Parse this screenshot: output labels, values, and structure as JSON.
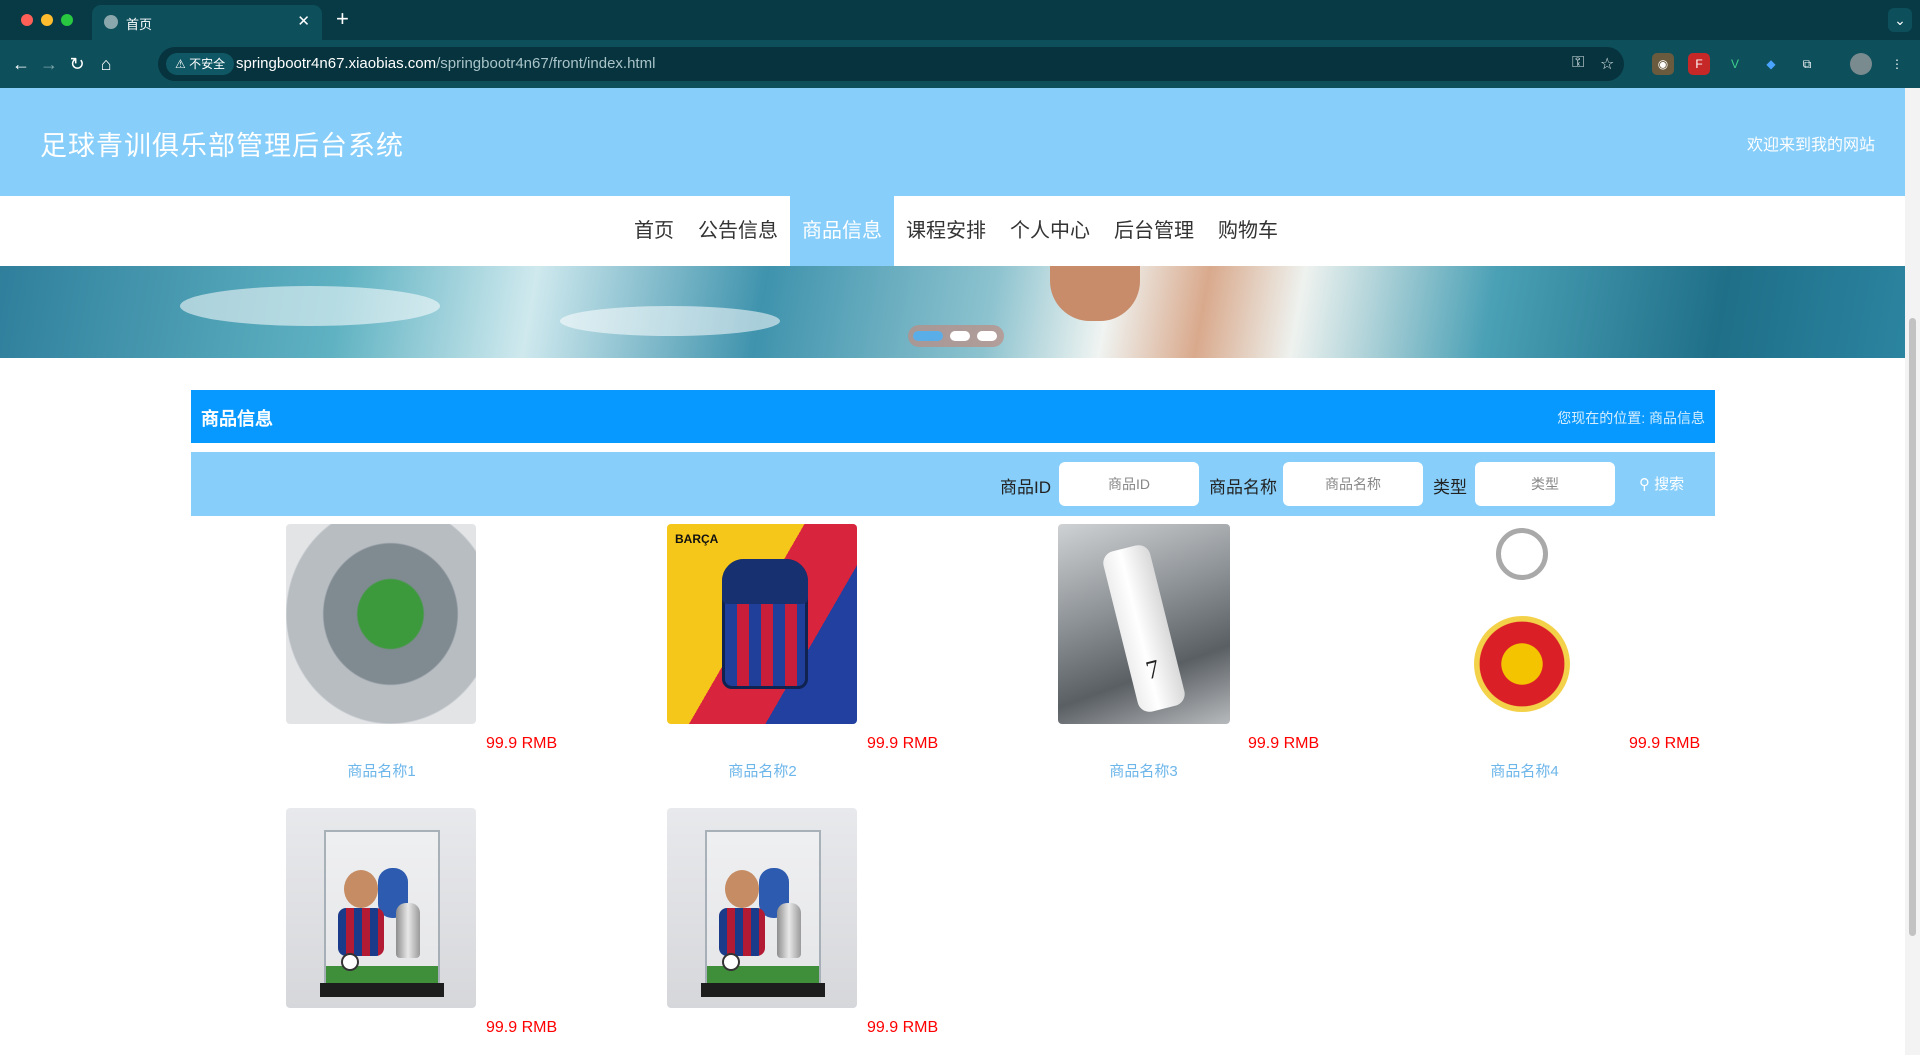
{
  "browser": {
    "tab_title": "首页",
    "tab_close": "✕",
    "new_tab": "+",
    "insecure_label": "不安全",
    "url_host": "springbootr4n67.xiaobias.com",
    "url_path": "/springbootr4n67/front/index.html"
  },
  "header": {
    "site_title": "足球青训俱乐部管理后台系统",
    "welcome": "欢迎来到我的网站"
  },
  "nav": {
    "items": [
      "首页",
      "公告信息",
      "商品信息",
      "课程安排",
      "个人中心",
      "后台管理",
      "购物车"
    ],
    "active_index": 2
  },
  "carousel": {
    "slide_count": 3,
    "active_slide": 1
  },
  "section": {
    "title": "商品信息",
    "breadcrumb_prefix": "您现在的位置:",
    "breadcrumb_current": "商品信息"
  },
  "search": {
    "id_label": "商品ID",
    "id_placeholder": "商品ID",
    "name_label": "商品名称",
    "name_placeholder": "商品名称",
    "type_label": "类型",
    "type_placeholder": "类型",
    "search_button": "搜索"
  },
  "products": [
    {
      "name": "商品名称1",
      "price": "99.9 RMB",
      "image": "stadium-model"
    },
    {
      "name": "商品名称2",
      "price": "99.9 RMB",
      "image": "barca-backpack",
      "image_text": "BARÇA"
    },
    {
      "name": "商品名称3",
      "price": "99.9 RMB",
      "image": "juventus-bottle",
      "image_text": "7"
    },
    {
      "name": "商品名称4",
      "price": "99.9 RMB",
      "image": "manutd-keyring"
    },
    {
      "name": "",
      "price": "99.9 RMB",
      "image": "messi-figure"
    },
    {
      "name": "",
      "price": "99.9 RMB",
      "image": "messi-figure"
    }
  ],
  "colors": {
    "header_bg": "#87cefa",
    "title_bar_bg": "#0799ff",
    "price": "#ff0000",
    "product_name": "#6cb6ea",
    "browser_bg": "#0d4f5b"
  }
}
